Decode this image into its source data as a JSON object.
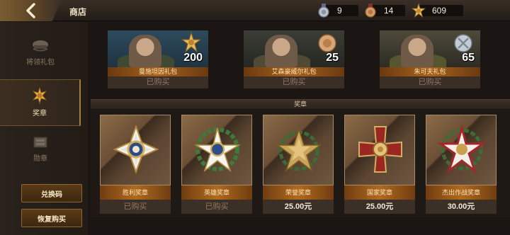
{
  "header": {
    "title": "商店",
    "currencies": [
      {
        "icon": "silver-medal-icon",
        "value": "9"
      },
      {
        "icon": "bronze-medal-icon",
        "value": "14"
      },
      {
        "icon": "gold-star-medal-icon",
        "value": "609"
      }
    ]
  },
  "sidebar": {
    "items": [
      {
        "label": "将领礼包",
        "icon": "officer-cap-icon"
      },
      {
        "label": "奖章",
        "icon": "medal-icon"
      },
      {
        "label": "勋章",
        "icon": "ribbon-box-icon"
      }
    ],
    "redeem_label": "兑换码",
    "restore_label": "恢复购买"
  },
  "packs": [
    {
      "name": "曼施坦因礼包",
      "count": "200",
      "status": "已购买"
    },
    {
      "name": "艾森豪威尔礼包",
      "count": "25",
      "status": "已购买"
    },
    {
      "name": "朱可夫礼包",
      "count": "65",
      "status": "已购买"
    }
  ],
  "medals_section": {
    "title": "奖章"
  },
  "medals": [
    {
      "name": "胜利奖章",
      "price": "已购买"
    },
    {
      "name": "英雄奖章",
      "price": "已购买"
    },
    {
      "name": "荣誉奖章",
      "price": "25.00元"
    },
    {
      "name": "国家奖章",
      "price": "25.00元"
    },
    {
      "name": "杰出作战奖章",
      "price": "30.00元"
    }
  ],
  "colors": {
    "accent_gold": "#b06a1f",
    "bg": "#1b1613",
    "owned_text": "#8a7b68"
  }
}
